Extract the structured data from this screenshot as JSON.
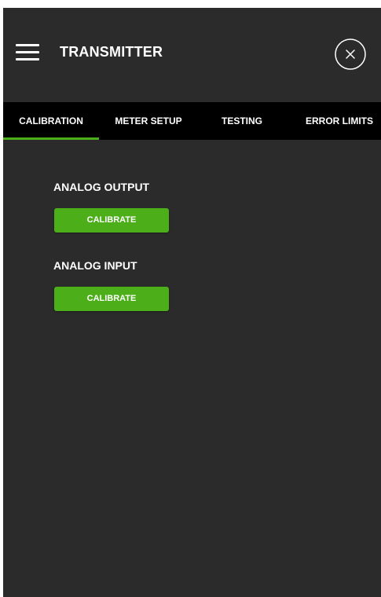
{
  "header": {
    "title": "TRANSMITTER",
    "menu_icon": "hamburger-menu-icon",
    "close_icon": "close-circle-icon"
  },
  "tabs": [
    {
      "label": "CALIBRATION",
      "active": true
    },
    {
      "label": "METER SETUP",
      "active": false
    },
    {
      "label": "TESTING",
      "active": false
    },
    {
      "label": "ERROR LIMITS",
      "active": false
    }
  ],
  "sections": [
    {
      "label": "ANALOG OUTPUT",
      "button_label": "CALIBRATE"
    },
    {
      "label": "ANALOG INPUT",
      "button_label": "CALIBRATE"
    }
  ],
  "colors": {
    "background": "#2b2b2b",
    "tab_bar": "#000000",
    "accent": "#4caf1a",
    "text": "#ffffff"
  }
}
